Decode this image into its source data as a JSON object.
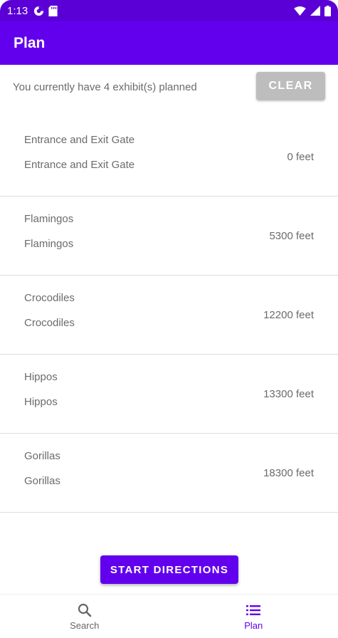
{
  "status_bar": {
    "time": "1:13",
    "left_icons": [
      "data-saver-icon",
      "sd-card-icon"
    ],
    "right_icons": [
      "wifi-icon",
      "signal-icon",
      "battery-icon"
    ]
  },
  "app_bar": {
    "title": "Plan"
  },
  "summary": {
    "text": "You currently have 4 exhibit(s) planned",
    "clear_label": "CLEAR"
  },
  "plan_items": [
    {
      "name": "Entrance and Exit Gate",
      "subtitle": "Entrance and Exit Gate",
      "distance": "0 feet"
    },
    {
      "name": "Flamingos",
      "subtitle": "Flamingos",
      "distance": "5300 feet"
    },
    {
      "name": "Crocodiles",
      "subtitle": "Crocodiles",
      "distance": "12200 feet"
    },
    {
      "name": "Hippos",
      "subtitle": "Hippos",
      "distance": "13300 feet"
    },
    {
      "name": "Gorillas",
      "subtitle": "Gorillas",
      "distance": "18300 feet"
    }
  ],
  "start_button": {
    "label": "START DIRECTIONS"
  },
  "bottom_nav": {
    "items": [
      {
        "label": "Search",
        "icon": "search-icon",
        "active": false
      },
      {
        "label": "Plan",
        "icon": "list-icon",
        "active": true
      }
    ]
  },
  "colors": {
    "primary": "#6200ee",
    "status_bar": "#5a00d6",
    "disabled_button": "#bdbdbd",
    "text_secondary": "#6b6b6b"
  }
}
